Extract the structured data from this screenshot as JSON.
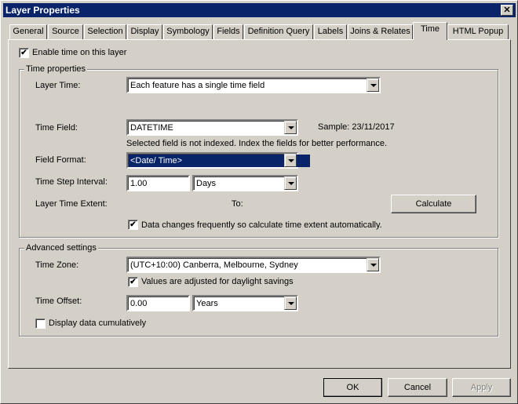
{
  "window": {
    "title": "Layer Properties",
    "close": "✕"
  },
  "tabs": [
    "General",
    "Source",
    "Selection",
    "Display",
    "Symbology",
    "Fields",
    "Definition Query",
    "Labels",
    "Joins & Relates",
    "Time",
    "HTML Popup"
  ],
  "active_tab": "Time",
  "enable_time": {
    "label": "Enable time on this layer",
    "checked": true,
    "mark": "✔"
  },
  "time_properties": {
    "title": "Time properties",
    "layer_time_label": "Layer Time:",
    "layer_time_value": "Each feature has a single time field",
    "time_field_label": "Time Field:",
    "time_field_value": "DATETIME",
    "sample": "Sample: 23/11/2017",
    "index_note": "Selected field is not indexed. Index the fields for better performance.",
    "field_format_label": "Field Format:",
    "field_format_value": "<Date/ Time>",
    "step_label": "Time Step Interval:",
    "step_value": "1.00",
    "step_unit": "Days",
    "extent_label": "Layer Time Extent:",
    "to_label": "To:",
    "calculate": "Calculate",
    "auto_calc": {
      "label": "Data changes frequently so calculate time extent automatically.",
      "checked": true
    }
  },
  "advanced": {
    "title": "Advanced settings",
    "zone_label": "Time Zone:",
    "zone_value": "(UTC+10:00) Canberra, Melbourne, Sydney",
    "daylight": {
      "label": "Values are adjusted for daylight savings",
      "checked": true
    },
    "offset_label": "Time Offset:",
    "offset_value": "0.00",
    "offset_unit": "Years",
    "cumulative": {
      "label": "Display data cumulatively",
      "checked": false
    }
  },
  "buttons": {
    "ok": "OK",
    "cancel": "Cancel",
    "apply": "Apply"
  }
}
